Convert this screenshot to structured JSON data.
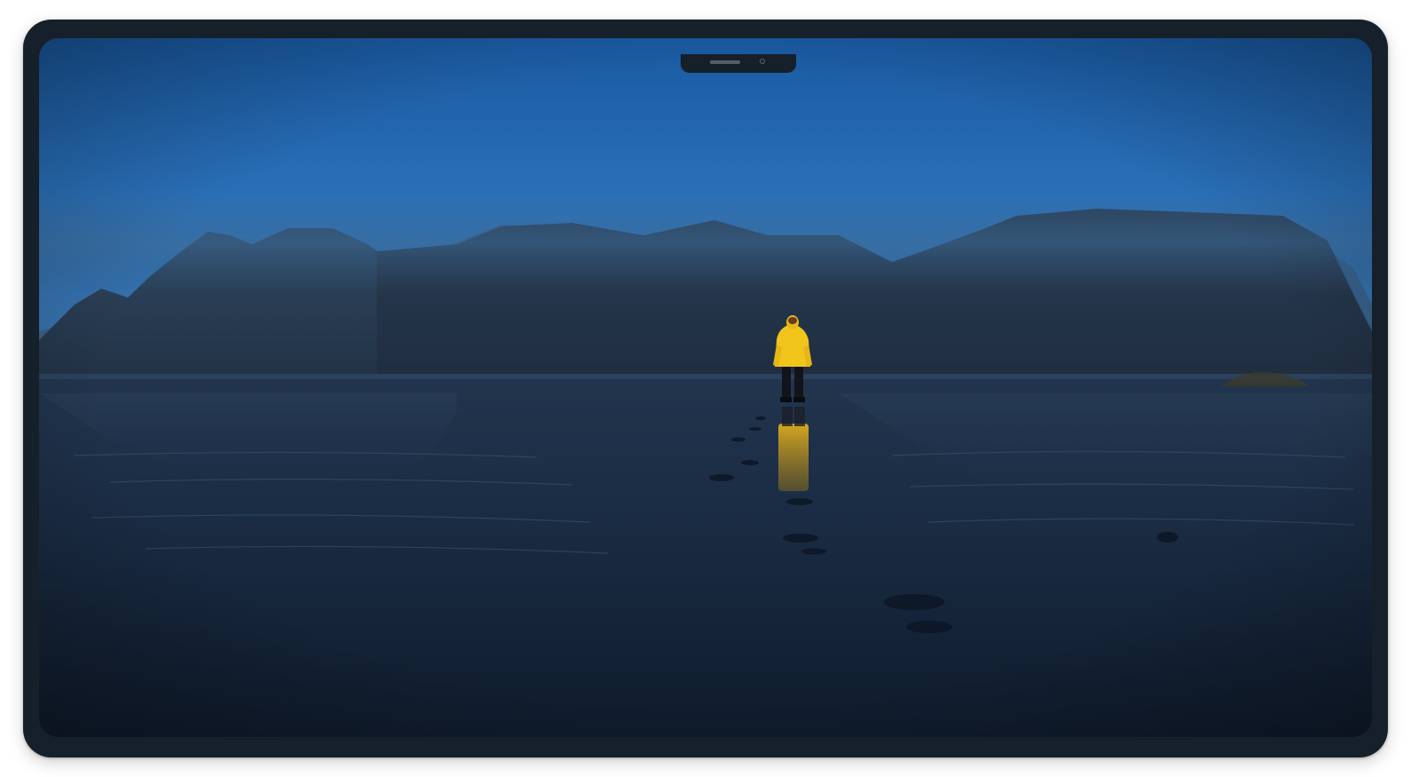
{
  "device": {
    "frame_color": "#16202b",
    "has_notch": true
  },
  "wallpaper": {
    "subject": "person-in-yellow-raincoat-on-wet-beach",
    "palette": {
      "sky_top": "#1c5fa8",
      "sky_mid": "#2d74bd",
      "mountain": "#283a4f",
      "beach": "#1a2c44",
      "raincoat": "#f0c420"
    }
  }
}
